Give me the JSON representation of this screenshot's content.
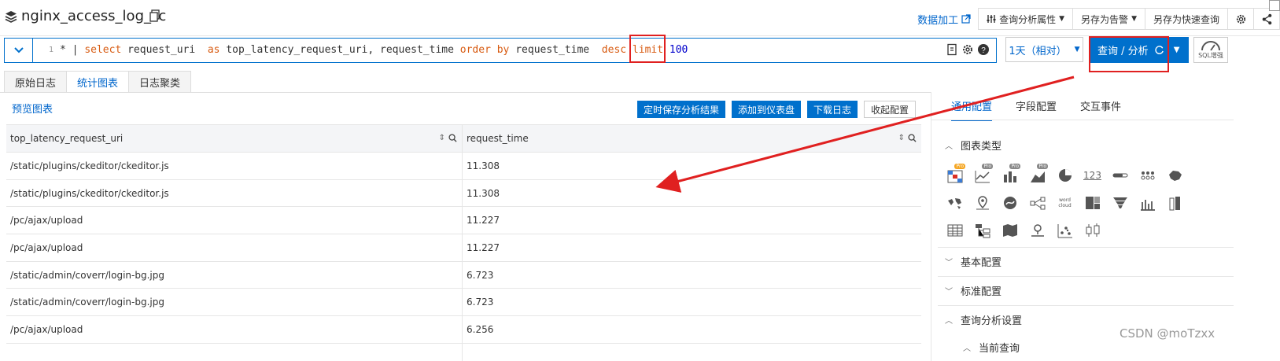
{
  "header": {
    "logstore_name": "nginx_access_log_zc",
    "data_processing": "数据加工",
    "query_props": "查询分析属性",
    "save_alert": "另存为告警",
    "save_quick": "另存为快速查询"
  },
  "query": {
    "line_number": "1",
    "segments": [
      {
        "t": "* | ",
        "k": "plain"
      },
      {
        "t": "select",
        "k": "kw"
      },
      {
        "t": " request_uri  ",
        "k": "plain"
      },
      {
        "t": "as",
        "k": "kw"
      },
      {
        "t": " top_latency_request_uri, request_time ",
        "k": "plain"
      },
      {
        "t": "order by",
        "k": "kw"
      },
      {
        "t": " request_time  ",
        "k": "plain"
      },
      {
        "t": "desc limit",
        "k": "kw"
      },
      {
        "t": " ",
        "k": "plain"
      },
      {
        "t": "100",
        "k": "num"
      }
    ],
    "time_range": "1天（相对）",
    "search_label": "查询 / 分析",
    "sql_label": "SQL增强"
  },
  "tabs": [
    "原始日志",
    "统计图表",
    "日志聚类"
  ],
  "active_tab": 1,
  "preview": {
    "title": "预览图表",
    "actions": [
      "定时保存分析结果",
      "添加到仪表盘",
      "下载日志"
    ],
    "collapse": "收起配置"
  },
  "table": {
    "columns": [
      "top_latency_request_uri",
      "request_time"
    ],
    "rows": [
      [
        "/static/plugins/ckeditor/ckeditor.js",
        "11.308"
      ],
      [
        "/static/plugins/ckeditor/ckeditor.js",
        "11.308"
      ],
      [
        "/pc/ajax/upload",
        "11.227"
      ],
      [
        "/pc/ajax/upload",
        "11.227"
      ],
      [
        "/static/admin/coverr/login-bg.jpg",
        "6.723"
      ],
      [
        "/static/admin/coverr/login-bg.jpg",
        "6.723"
      ],
      [
        "/pc/ajax/upload",
        "6.256"
      ],
      [
        "",
        ""
      ]
    ]
  },
  "right_panel": {
    "tabs": [
      "通用配置",
      "字段配置",
      "交互事件"
    ],
    "sections": [
      "图表类型",
      "基本配置",
      "标准配置",
      "查询分析设置",
      "当前查询"
    ],
    "chart_icons": [
      "pro-table-icon",
      "pro-line-icon",
      "pro-bar-icon",
      "pro-area-icon",
      "pie-chart-icon",
      "number-icon",
      "progress-bar-icon",
      "dots-table-icon",
      "china-map-icon",
      "world-map-icon",
      "amap-icon",
      "flow-icon",
      "sankey-icon",
      "word-cloud-icon",
      "treemap-icon",
      "funnel-icon",
      "column-icon",
      "bar-icon",
      "table-icon",
      "topology-icon",
      "area-map-icon",
      "map-pin-icon",
      "scatter-icon",
      "boxplot-icon"
    ],
    "badge": "Pro",
    "number_glyph": "123",
    "wordcloud_glyph": "word cloud"
  },
  "watermark": "CSDN @moTzxx",
  "colors": {
    "accent": "#0070cc",
    "highlight": "#e02020"
  }
}
